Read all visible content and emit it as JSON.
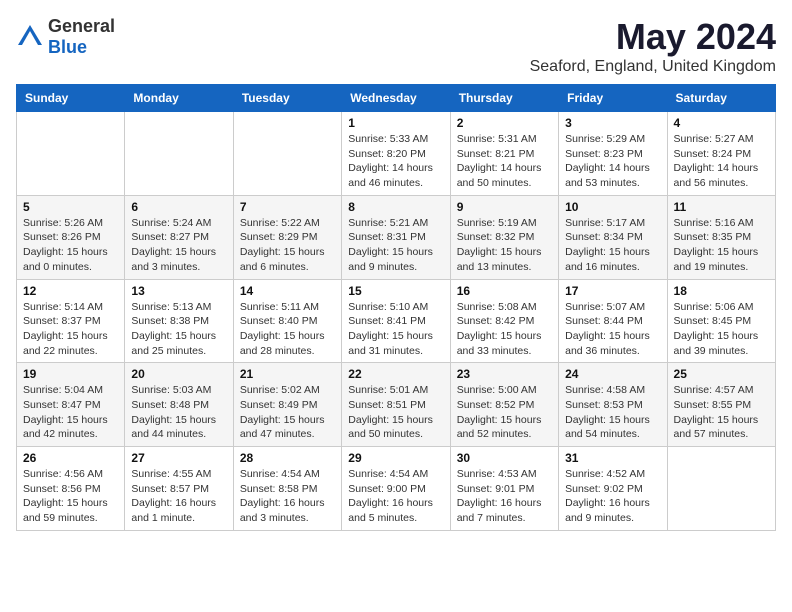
{
  "logo": {
    "general": "General",
    "blue": "Blue"
  },
  "title": {
    "month": "May 2024",
    "location": "Seaford, England, United Kingdom"
  },
  "weekdays": [
    "Sunday",
    "Monday",
    "Tuesday",
    "Wednesday",
    "Thursday",
    "Friday",
    "Saturday"
  ],
  "weeks": [
    [
      {
        "day": "",
        "info": ""
      },
      {
        "day": "",
        "info": ""
      },
      {
        "day": "",
        "info": ""
      },
      {
        "day": "1",
        "info": "Sunrise: 5:33 AM\nSunset: 8:20 PM\nDaylight: 14 hours\nand 46 minutes."
      },
      {
        "day": "2",
        "info": "Sunrise: 5:31 AM\nSunset: 8:21 PM\nDaylight: 14 hours\nand 50 minutes."
      },
      {
        "day": "3",
        "info": "Sunrise: 5:29 AM\nSunset: 8:23 PM\nDaylight: 14 hours\nand 53 minutes."
      },
      {
        "day": "4",
        "info": "Sunrise: 5:27 AM\nSunset: 8:24 PM\nDaylight: 14 hours\nand 56 minutes."
      }
    ],
    [
      {
        "day": "5",
        "info": "Sunrise: 5:26 AM\nSunset: 8:26 PM\nDaylight: 15 hours\nand 0 minutes."
      },
      {
        "day": "6",
        "info": "Sunrise: 5:24 AM\nSunset: 8:27 PM\nDaylight: 15 hours\nand 3 minutes."
      },
      {
        "day": "7",
        "info": "Sunrise: 5:22 AM\nSunset: 8:29 PM\nDaylight: 15 hours\nand 6 minutes."
      },
      {
        "day": "8",
        "info": "Sunrise: 5:21 AM\nSunset: 8:31 PM\nDaylight: 15 hours\nand 9 minutes."
      },
      {
        "day": "9",
        "info": "Sunrise: 5:19 AM\nSunset: 8:32 PM\nDaylight: 15 hours\nand 13 minutes."
      },
      {
        "day": "10",
        "info": "Sunrise: 5:17 AM\nSunset: 8:34 PM\nDaylight: 15 hours\nand 16 minutes."
      },
      {
        "day": "11",
        "info": "Sunrise: 5:16 AM\nSunset: 8:35 PM\nDaylight: 15 hours\nand 19 minutes."
      }
    ],
    [
      {
        "day": "12",
        "info": "Sunrise: 5:14 AM\nSunset: 8:37 PM\nDaylight: 15 hours\nand 22 minutes."
      },
      {
        "day": "13",
        "info": "Sunrise: 5:13 AM\nSunset: 8:38 PM\nDaylight: 15 hours\nand 25 minutes."
      },
      {
        "day": "14",
        "info": "Sunrise: 5:11 AM\nSunset: 8:40 PM\nDaylight: 15 hours\nand 28 minutes."
      },
      {
        "day": "15",
        "info": "Sunrise: 5:10 AM\nSunset: 8:41 PM\nDaylight: 15 hours\nand 31 minutes."
      },
      {
        "day": "16",
        "info": "Sunrise: 5:08 AM\nSunset: 8:42 PM\nDaylight: 15 hours\nand 33 minutes."
      },
      {
        "day": "17",
        "info": "Sunrise: 5:07 AM\nSunset: 8:44 PM\nDaylight: 15 hours\nand 36 minutes."
      },
      {
        "day": "18",
        "info": "Sunrise: 5:06 AM\nSunset: 8:45 PM\nDaylight: 15 hours\nand 39 minutes."
      }
    ],
    [
      {
        "day": "19",
        "info": "Sunrise: 5:04 AM\nSunset: 8:47 PM\nDaylight: 15 hours\nand 42 minutes."
      },
      {
        "day": "20",
        "info": "Sunrise: 5:03 AM\nSunset: 8:48 PM\nDaylight: 15 hours\nand 44 minutes."
      },
      {
        "day": "21",
        "info": "Sunrise: 5:02 AM\nSunset: 8:49 PM\nDaylight: 15 hours\nand 47 minutes."
      },
      {
        "day": "22",
        "info": "Sunrise: 5:01 AM\nSunset: 8:51 PM\nDaylight: 15 hours\nand 50 minutes."
      },
      {
        "day": "23",
        "info": "Sunrise: 5:00 AM\nSunset: 8:52 PM\nDaylight: 15 hours\nand 52 minutes."
      },
      {
        "day": "24",
        "info": "Sunrise: 4:58 AM\nSunset: 8:53 PM\nDaylight: 15 hours\nand 54 minutes."
      },
      {
        "day": "25",
        "info": "Sunrise: 4:57 AM\nSunset: 8:55 PM\nDaylight: 15 hours\nand 57 minutes."
      }
    ],
    [
      {
        "day": "26",
        "info": "Sunrise: 4:56 AM\nSunset: 8:56 PM\nDaylight: 15 hours\nand 59 minutes."
      },
      {
        "day": "27",
        "info": "Sunrise: 4:55 AM\nSunset: 8:57 PM\nDaylight: 16 hours\nand 1 minute."
      },
      {
        "day": "28",
        "info": "Sunrise: 4:54 AM\nSunset: 8:58 PM\nDaylight: 16 hours\nand 3 minutes."
      },
      {
        "day": "29",
        "info": "Sunrise: 4:54 AM\nSunset: 9:00 PM\nDaylight: 16 hours\nand 5 minutes."
      },
      {
        "day": "30",
        "info": "Sunrise: 4:53 AM\nSunset: 9:01 PM\nDaylight: 16 hours\nand 7 minutes."
      },
      {
        "day": "31",
        "info": "Sunrise: 4:52 AM\nSunset: 9:02 PM\nDaylight: 16 hours\nand 9 minutes."
      },
      {
        "day": "",
        "info": ""
      }
    ]
  ]
}
